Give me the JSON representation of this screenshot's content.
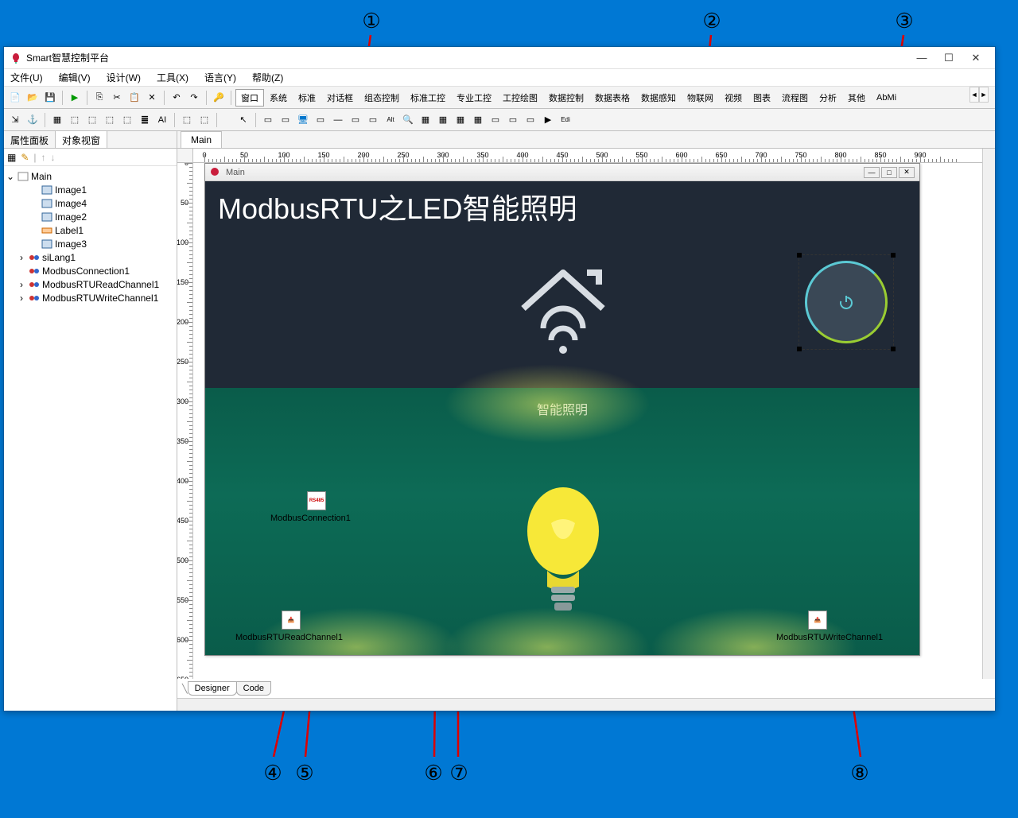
{
  "window": {
    "title": "Smart智慧控制平台"
  },
  "menus": [
    "文件(U)",
    "编辑(V)",
    "设计(W)",
    "工具(X)",
    "语言(Y)",
    "帮助(Z)"
  ],
  "sidepanel": {
    "tabs": [
      "属性面板",
      "对象视窗"
    ],
    "tree": {
      "root": "Main",
      "children": [
        {
          "label": "Image1",
          "icon": "img"
        },
        {
          "label": "Image4",
          "icon": "img"
        },
        {
          "label": "Image2",
          "icon": "img"
        },
        {
          "label": "Label1",
          "icon": "lbl"
        },
        {
          "label": "Image3",
          "icon": "img"
        },
        {
          "label": "siLang1",
          "icon": "comp",
          "expand": true
        },
        {
          "label": "ModbusConnection1",
          "icon": "comp"
        },
        {
          "label": "ModbusRTUReadChannel1",
          "icon": "comp",
          "expand": true
        },
        {
          "label": "ModbusRTUWriteChannel1",
          "icon": "comp",
          "expand": true
        }
      ]
    }
  },
  "doc": {
    "tab": "Main",
    "form_title": "Main"
  },
  "form": {
    "hero_title": "ModbusRTU之LED智能照明",
    "lower_title": "智能照明",
    "components": {
      "conn": "ModbusConnection1",
      "read": "ModbusRTUReadChannel1",
      "write": "ModbusRTUWriteChannel1"
    }
  },
  "bottom_tabs": [
    "Designer",
    "Code"
  ],
  "toolbar_tabs": [
    "窗口",
    "系统",
    "标准",
    "对话框",
    "组态控制",
    "标准工控",
    "专业工控",
    "工控绘图",
    "数据控制",
    "数据表格",
    "数据感知",
    "物联网",
    "视频",
    "图表",
    "流程图",
    "分析",
    "其他"
  ],
  "toolbar_extra": "AbMi",
  "annotations": [
    "①",
    "②",
    "③",
    "④",
    "⑤",
    "⑥",
    "⑦",
    "⑧"
  ],
  "hruler": [
    "0",
    "50",
    "100",
    "150",
    "200",
    "250",
    "300",
    "350",
    "400",
    "450",
    "500",
    "550",
    "600",
    "650",
    "700",
    "750",
    "800",
    "850",
    "900"
  ],
  "vruler": [
    "0",
    "50",
    "100",
    "150",
    "200",
    "250",
    "300",
    "350",
    "400",
    "450",
    "500",
    "550",
    "600",
    "650"
  ]
}
